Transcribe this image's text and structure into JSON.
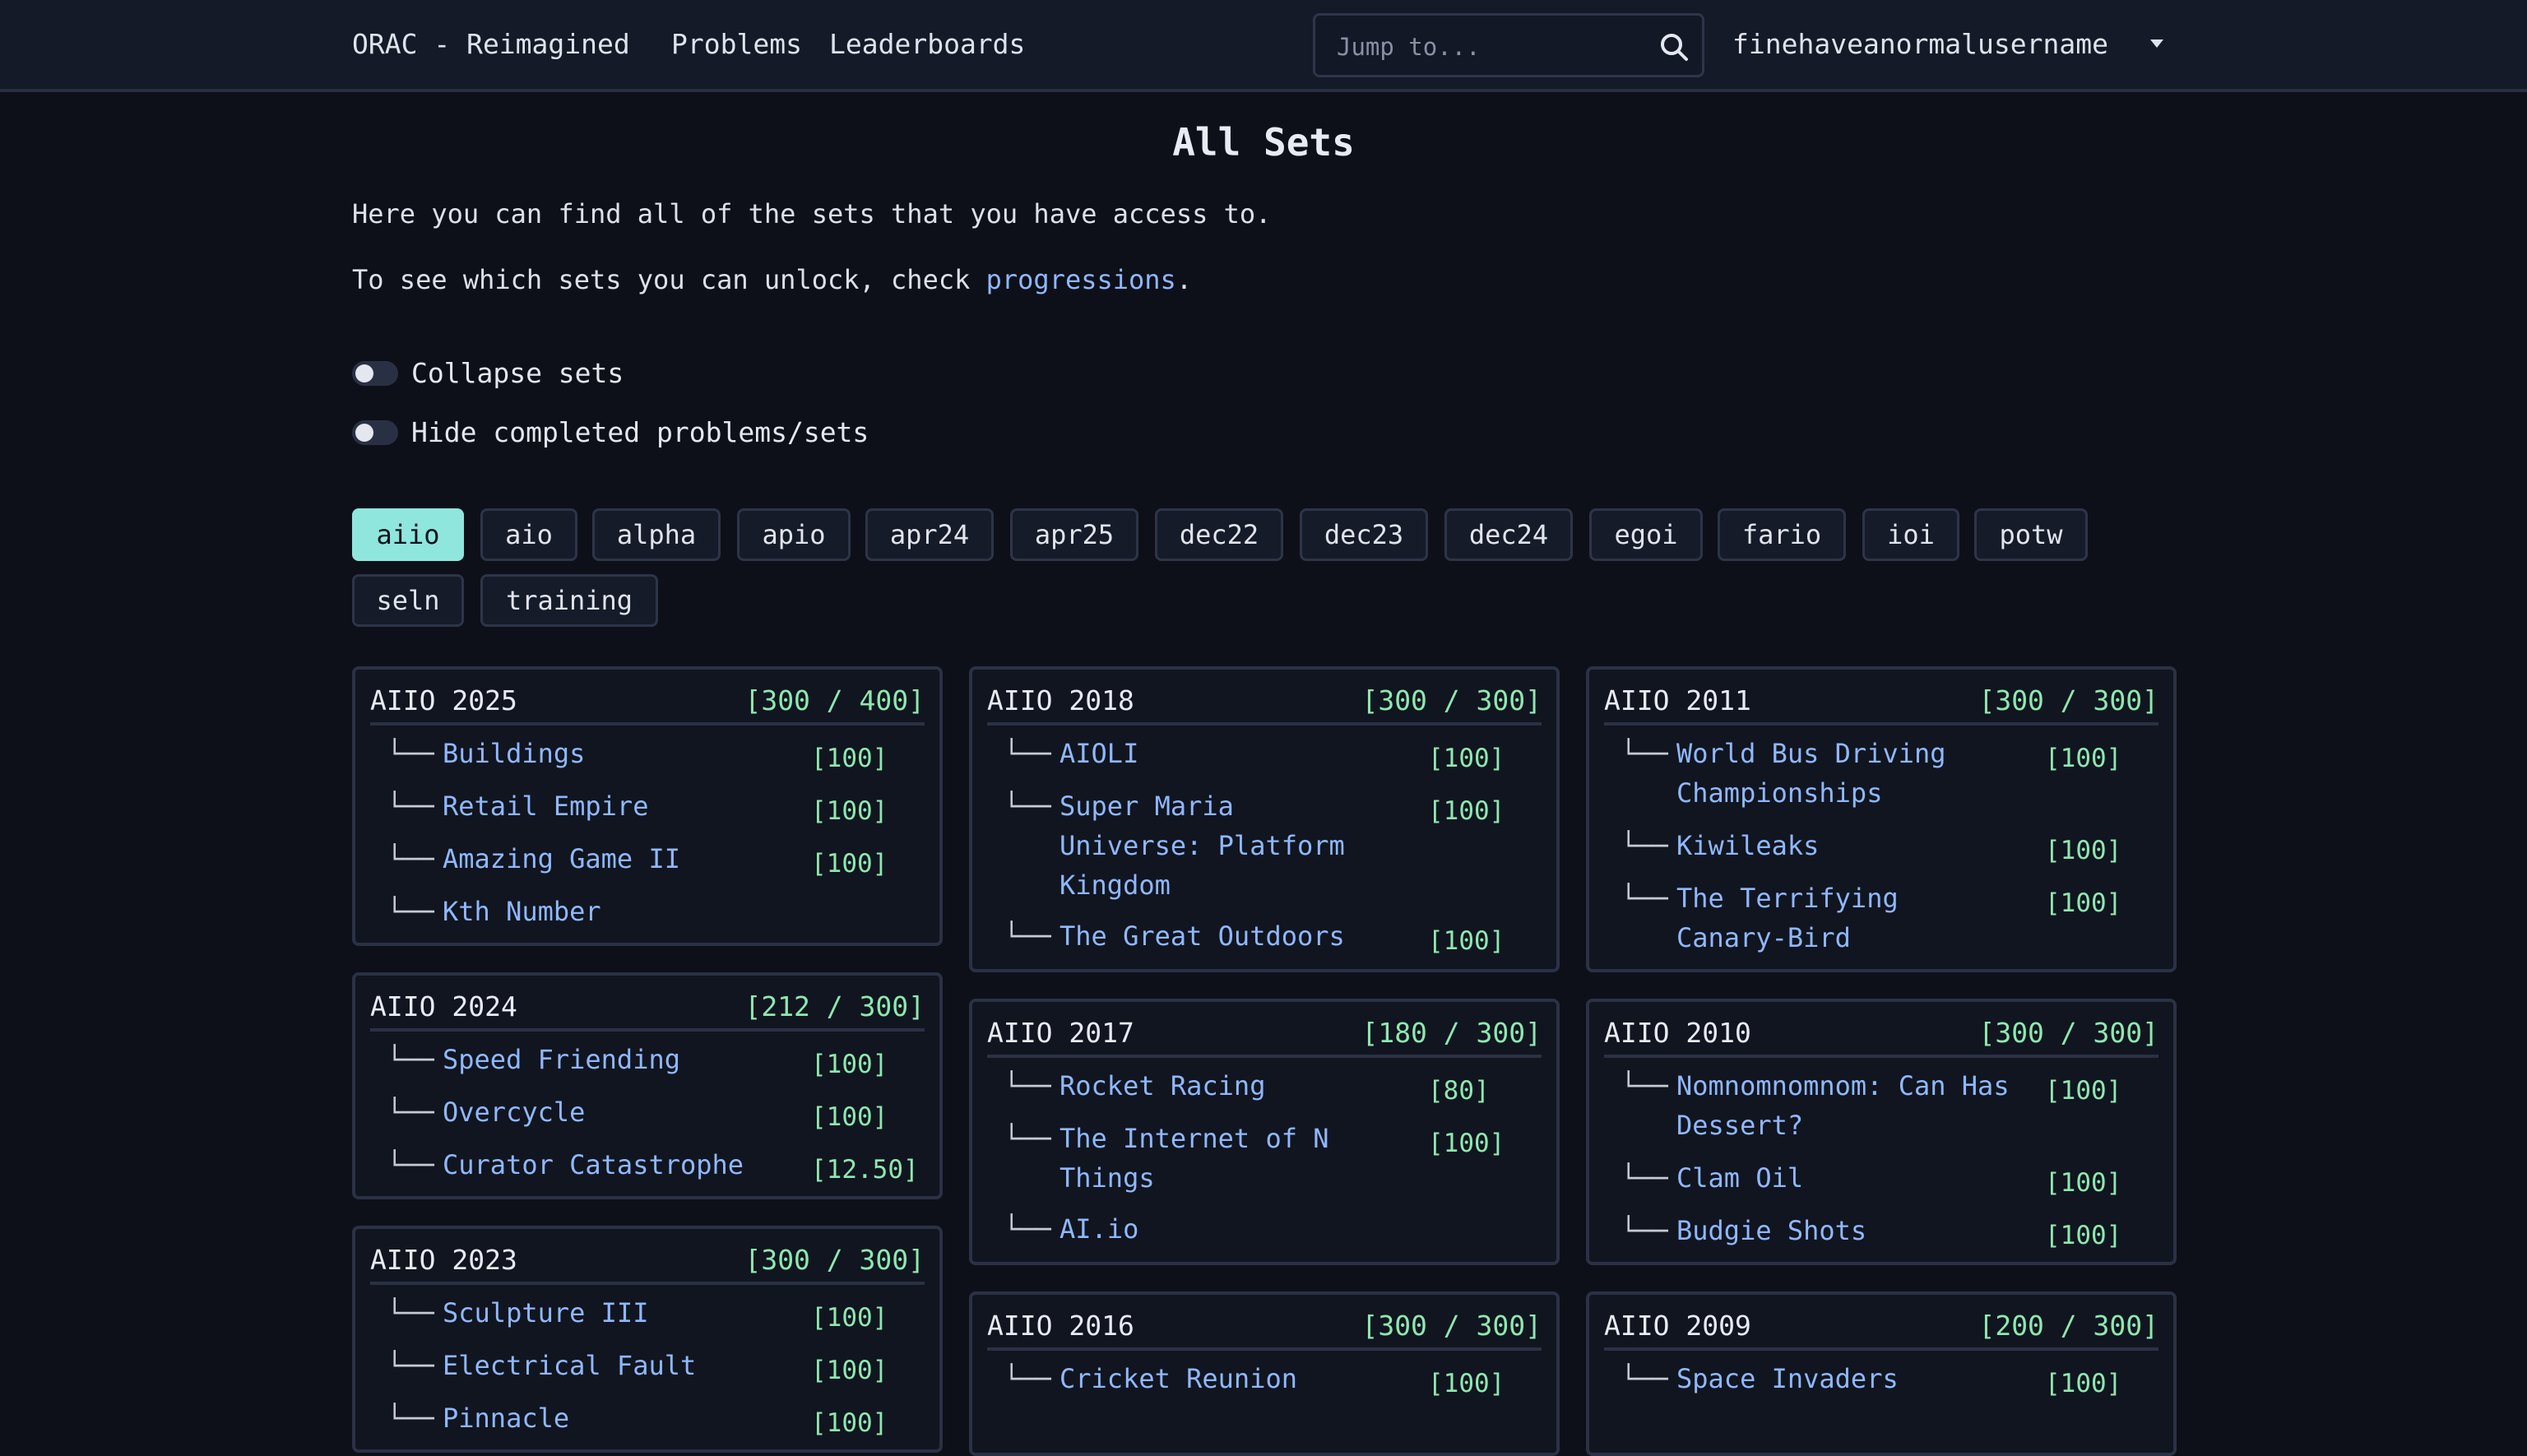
{
  "navbar": {
    "brand": "ORAC - Reimagined",
    "links": [
      "Problems",
      "Leaderboards"
    ],
    "search_placeholder": "Jump to...",
    "username": "finehaveanormalusername"
  },
  "page": {
    "title": "All Sets",
    "intro": "Here you can find all of the sets that you have access to.",
    "unlock_prefix": "To see which sets you can unlock, check ",
    "unlock_link": "progressions",
    "unlock_suffix": "."
  },
  "toggles": {
    "collapse": "Collapse sets",
    "hide_completed": "Hide completed problems/sets"
  },
  "tags": {
    "active": "aiio",
    "items": [
      "aiio",
      "aio",
      "alpha",
      "apio",
      "apr24",
      "apr25",
      "dec22",
      "dec23",
      "dec24",
      "egoi",
      "fario",
      "ioi",
      "potw",
      "seln",
      "training"
    ]
  },
  "sets": [
    {
      "title": "AIIO 2025",
      "score": "[300 / 400]",
      "problems": [
        {
          "branch": "└──",
          "name": "Buildings",
          "score": "[100]"
        },
        {
          "branch": "└──",
          "name": "Retail Empire",
          "score": "[100]"
        },
        {
          "branch": "└──",
          "name": "Amazing Game II",
          "score": "[100]"
        },
        {
          "branch": "└──",
          "name": "Kth Number",
          "score": ""
        }
      ]
    },
    {
      "title": "AIIO 2024",
      "score": "[212 / 300]",
      "problems": [
        {
          "branch": "└──",
          "name": "Speed Friending",
          "score": "[100]"
        },
        {
          "branch": "└──",
          "name": "Overcycle",
          "score": "[100]"
        },
        {
          "branch": "└──",
          "name": "Curator Catastrophe",
          "score": "[12.50]"
        }
      ]
    },
    {
      "title": "AIIO 2023",
      "score": "[300 / 300]",
      "problems": [
        {
          "branch": "└──",
          "name": "Sculpture III",
          "score": "[100]"
        },
        {
          "branch": "└──",
          "name": "Electrical Fault",
          "score": "[100]"
        },
        {
          "branch": "└──",
          "name": "Pinnacle",
          "score": "[100]"
        }
      ]
    },
    {
      "title": "AIIO 2018",
      "score": "[300 / 300]",
      "problems": [
        {
          "branch": "└──",
          "name": "AIOLI",
          "score": "[100]"
        },
        {
          "branch": "└──",
          "name": "Super Maria Universe: Platform Kingdom",
          "score": "[100]"
        },
        {
          "branch": "└──",
          "name": "The Great Outdoors",
          "score": "[100]"
        }
      ]
    },
    {
      "title": "AIIO 2017",
      "score": "[180 / 300]",
      "problems": [
        {
          "branch": "└──",
          "name": "Rocket Racing",
          "score": "[80]"
        },
        {
          "branch": "└──",
          "name": "The Internet of N Things",
          "score": "[100]"
        },
        {
          "branch": "└──",
          "name": "AI.io",
          "score": ""
        }
      ]
    },
    {
      "title": "AIIO 2016",
      "score": "[300 / 300]",
      "problems": [
        {
          "branch": "└──",
          "name": "Cricket Reunion",
          "score": "[100]"
        }
      ]
    },
    {
      "title": "AIIO 2011",
      "score": "[300 / 300]",
      "problems": [
        {
          "branch": "└──",
          "name": "World Bus Driving Championships",
          "score": "[100]"
        },
        {
          "branch": "└──",
          "name": "Kiwileaks",
          "score": "[100]"
        },
        {
          "branch": "└──",
          "name": "The Terrifying Canary-Bird",
          "score": "[100]"
        }
      ]
    },
    {
      "title": "AIIO 2010",
      "score": "[300 / 300]",
      "problems": [
        {
          "branch": "└──",
          "name": "Nomnomnomnom: Can Has Dessert?",
          "score": "[100]"
        },
        {
          "branch": "└──",
          "name": "Clam Oil",
          "score": "[100]"
        },
        {
          "branch": "└──",
          "name": "Budgie Shots",
          "score": "[100]"
        }
      ]
    },
    {
      "title": "AIIO 2009",
      "score": "[200 / 300]",
      "problems": [
        {
          "branch": "└──",
          "name": "Space Invaders",
          "score": "[100]"
        }
      ]
    }
  ],
  "colors": {
    "background": "#0e1019",
    "navbar": "#151a29",
    "link": "#8fb8ff",
    "score": "#8ee8b0",
    "active_tag": "#8fe6dc"
  }
}
